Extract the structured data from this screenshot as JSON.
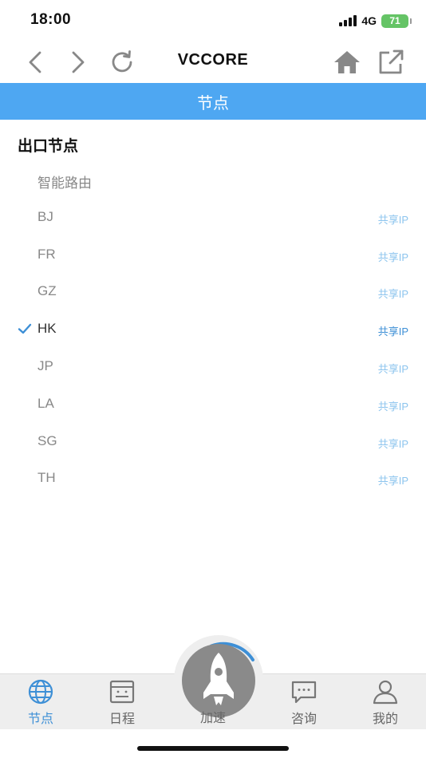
{
  "status_bar": {
    "time": "18:00",
    "network": "4G",
    "battery": "71"
  },
  "toolbar": {
    "title": "VCCORE",
    "icons": [
      "back-icon",
      "forward-icon",
      "refresh-icon",
      "home-icon",
      "open-external-icon"
    ]
  },
  "header": {
    "title": "节点"
  },
  "section": {
    "title": "出口节点"
  },
  "nodes": [
    {
      "name": "智能路由",
      "tag": "",
      "selected": false
    },
    {
      "name": "BJ",
      "tag": "共享IP",
      "selected": false
    },
    {
      "name": "FR",
      "tag": "共享IP",
      "selected": false
    },
    {
      "name": "GZ",
      "tag": "共享IP",
      "selected": false
    },
    {
      "name": "HK",
      "tag": "共享IP",
      "selected": true
    },
    {
      "name": "JP",
      "tag": "共享IP",
      "selected": false
    },
    {
      "name": "LA",
      "tag": "共享IP",
      "selected": false
    },
    {
      "name": "SG",
      "tag": "共享IP",
      "selected": false
    },
    {
      "name": "TH",
      "tag": "共享IP",
      "selected": false
    }
  ],
  "tabbar": {
    "tabs": [
      {
        "label": "节点",
        "icon": "globe-icon",
        "active": true
      },
      {
        "label": "日程",
        "icon": "schedule-icon",
        "active": false
      },
      {
        "label": "加速",
        "icon": "rocket-icon",
        "active": false
      },
      {
        "label": "咨询",
        "icon": "chat-icon",
        "active": false
      },
      {
        "label": "我的",
        "icon": "user-icon",
        "active": false
      }
    ]
  },
  "colors": {
    "accent": "#4ea7f2",
    "selected_tag": "#3d8fd6",
    "tag": "#8cc4ee",
    "battery": "#65c466"
  }
}
